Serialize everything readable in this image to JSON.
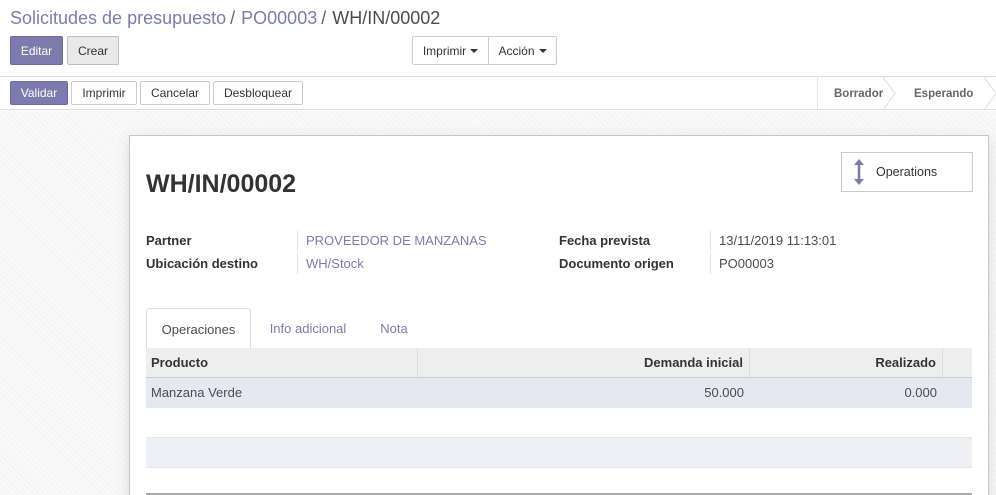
{
  "breadcrumb": {
    "item1": "Solicitudes de presupuesto",
    "item2": "PO00003",
    "current": "WH/IN/00002",
    "separator": "/"
  },
  "toolbar": {
    "edit_label": "Editar",
    "create_label": "Crear",
    "print_label": "Imprimir",
    "action_label": "Acción"
  },
  "statusbar": {
    "validate_label": "Validar",
    "print_label": "Imprimir",
    "cancel_label": "Cancelar",
    "unlock_label": "Desbloquear",
    "stages": [
      "Borrador",
      "Esperando"
    ]
  },
  "form": {
    "title": "WH/IN/00002",
    "smart_button_label": "Operations",
    "smart_button_icon": "arrows-v-icon",
    "fields": {
      "partner_label": "Partner",
      "partner_value": "PROVEEDOR DE MANZANAS",
      "dest_label": "Ubicación destino",
      "dest_value": "WH/Stock",
      "date_label": "Fecha prevista",
      "date_value": "13/11/2019 11:13:01",
      "origin_label": "Documento origen",
      "origin_value": "PO00003"
    },
    "tabs": [
      "Operaciones",
      "Info adicional",
      "Nota"
    ],
    "table": {
      "headers": [
        "Producto",
        "Demanda inicial",
        "Realizado"
      ],
      "rows": [
        {
          "product": "Manzana Verde",
          "demand": "50.000",
          "done": "0.000"
        }
      ]
    }
  },
  "colors": {
    "accent": "#7c7bad",
    "text": "#4c4c4c"
  }
}
